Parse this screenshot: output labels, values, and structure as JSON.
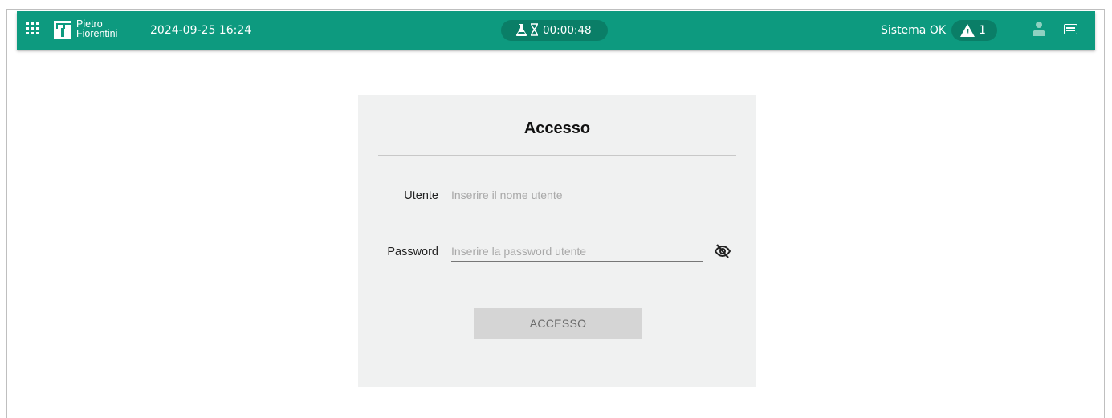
{
  "header": {
    "brand_line1": "Pietro",
    "brand_line2": "Fiorentini",
    "datetime": "2024-09-25 16:24",
    "timer": "00:00:48",
    "system_status": "Sistema OK",
    "alarm_count": "1",
    "accent_color": "#0d9a7f"
  },
  "login": {
    "title": "Accesso",
    "user_label": "Utente",
    "user_value": "",
    "user_placeholder": "Inserire il nome utente",
    "password_label": "Password",
    "password_value": "",
    "password_placeholder": "Inserire la password utente",
    "submit_label": "ACCESSO",
    "submit_enabled": false
  },
  "icons": {
    "apps": "apps-grid-icon",
    "logo": "pietro-fiorentini-logo",
    "flask": "flask-icon",
    "hourglass": "hourglass-icon",
    "alarm": "warning-triangle-icon",
    "user": "user-icon",
    "keyboard": "keyboard-icon",
    "visibility": "eye-off-icon"
  }
}
